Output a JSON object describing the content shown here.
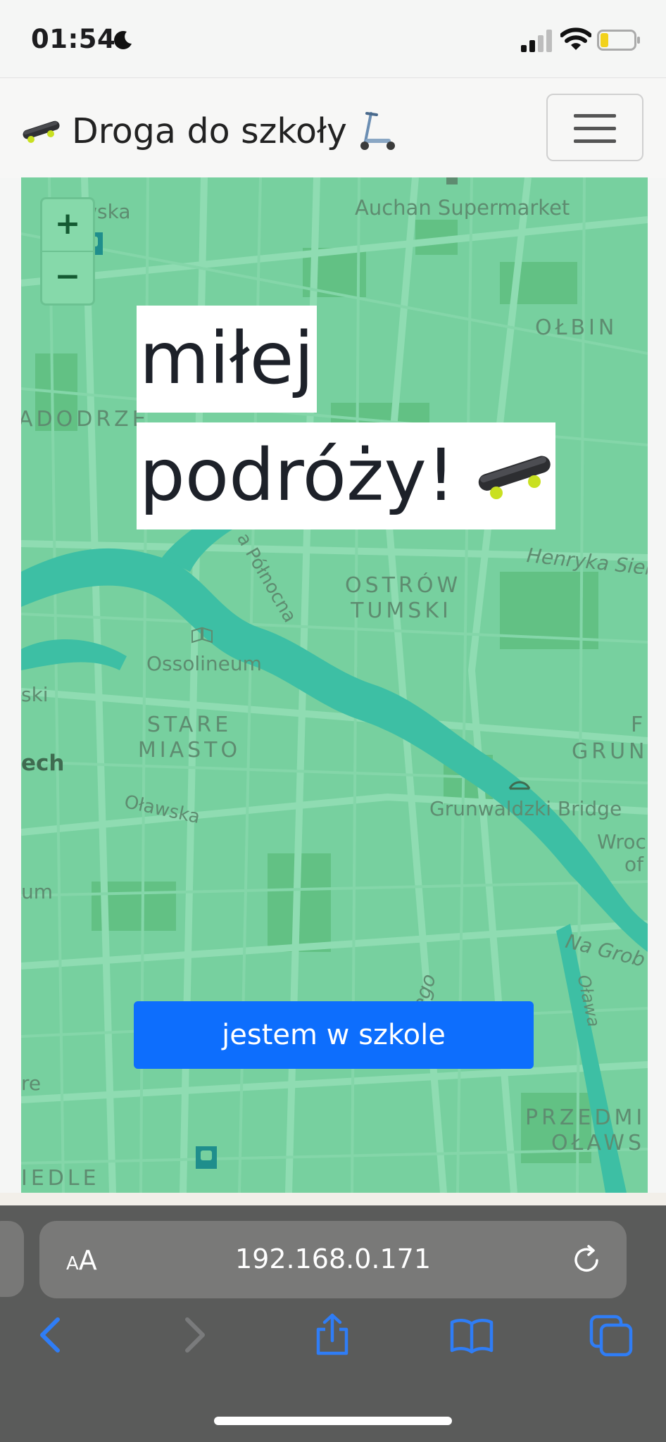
{
  "status_bar": {
    "time": "01:54"
  },
  "navbar": {
    "brand_text": "Droga do szkoły",
    "brand_icons": [
      "skateboard-icon",
      "scooter-icon"
    ],
    "menu_icon": "hamburger-menu-icon"
  },
  "map": {
    "zoom_in_label": "+",
    "zoom_out_label": "−",
    "labels": {
      "owska": "owska",
      "auchan": "Auchan Supermarket",
      "olbin": "OŁBIN",
      "nadodrze": "ADODRZE",
      "henryka": "Henryka Sien",
      "odra": "a Północna",
      "ostrow_line1": "OSTRÓW",
      "ostrow_line2": "TUMSKI",
      "ossolineum": "Ossolineum",
      "ski": "ski",
      "stare_line1": "STARE",
      "stare_line2": "MIASTO",
      "ech": "ech",
      "f": "F",
      "grun": "GRUN",
      "olawska": "Oławska",
      "grunwaldzki_bridge": "Grunwaldzki Bridge",
      "wroc_line1": "Wroc",
      "wroc_line2": "of",
      "um": "um",
      "na_grob": "Na Grob",
      "iego": "iego",
      "olawa": "Oława",
      "re": "re",
      "przedmiescie_line1": "PRZEDMI",
      "przedmiescie_line2": "OŁAWS",
      "iedle": "IEDLE"
    }
  },
  "greeting": {
    "line1": "miłej",
    "line2": "podróży!",
    "icon": "skateboard-icon"
  },
  "school_button_label": "jestem w szkole",
  "browser": {
    "aa_label_small": "A",
    "aa_label_large": "A",
    "url": "192.168.0.171",
    "icons": [
      "back-icon",
      "forward-icon",
      "share-icon",
      "bookmarks-icon",
      "tabs-icon",
      "reload-icon"
    ]
  },
  "colors": {
    "map_overlay": "#77d09f",
    "button": "#0d6efd",
    "river": "#3dbfa4",
    "browser_toolbar": "#5a5b5a"
  }
}
